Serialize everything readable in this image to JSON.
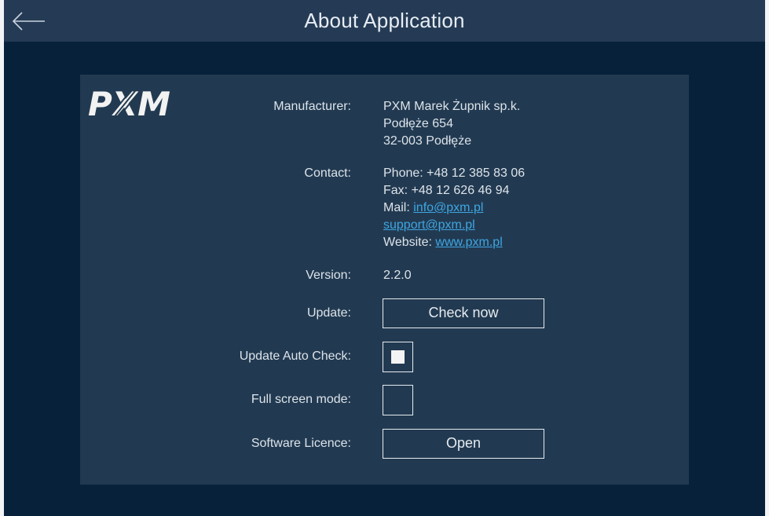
{
  "header": {
    "title": "About Application"
  },
  "logo_text": "PXM",
  "manufacturer": {
    "label": "Manufacturer:",
    "line1": "PXM Marek Żupnik sp.k.",
    "line2": "Podłęże 654",
    "line3": "32-003 Podłęże"
  },
  "contact": {
    "label": "Contact:",
    "phone": "Phone: +48 12 385 83 06",
    "fax": "Fax: +48 12 626 46 94",
    "mail_prefix": "Mail: ",
    "mail_link": "info@pxm.pl",
    "support_link": "support@pxm.pl",
    "website_prefix": "Website: ",
    "website_link": "www.pxm.pl"
  },
  "version": {
    "label": "Version:",
    "value": "2.2.0"
  },
  "update": {
    "label": "Update:",
    "button": "Check now"
  },
  "auto_check": {
    "label": "Update Auto Check:",
    "checked": true
  },
  "full_screen": {
    "label": "Full screen mode:",
    "checked": false
  },
  "licence": {
    "label": "Software Licence:",
    "button": "Open"
  },
  "colors": {
    "background": "#07213a",
    "panel": "#223a51",
    "titlebar": "#253b55",
    "link": "#3ea6e3"
  },
  "icons": {
    "back": "arrow-left-icon"
  }
}
